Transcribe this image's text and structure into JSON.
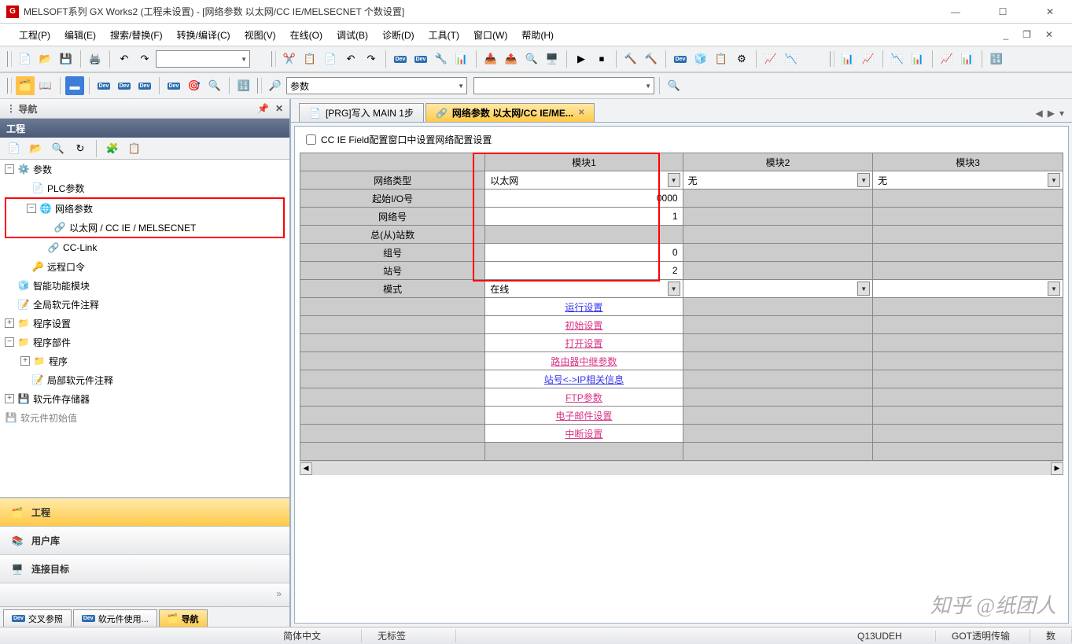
{
  "title": "MELSOFT系列 GX Works2 (工程未设置) - [网络参数  以太网/CC IE/MELSECNET 个数设置]",
  "menus": [
    "工程(P)",
    "编辑(E)",
    "搜索/替换(F)",
    "转换/编译(C)",
    "视图(V)",
    "在线(O)",
    "调试(B)",
    "诊断(D)",
    "工具(T)",
    "窗口(W)",
    "帮助(H)"
  ],
  "combo_param": "参数",
  "nav_title": "导航",
  "nav_sub": "工程",
  "tree": {
    "root": "参数",
    "plc": "PLC参数",
    "net": "网络参数",
    "eth": "以太网 / CC IE / MELSECNET",
    "cclink": "CC-Link",
    "remote": "远程口令",
    "smart": "智能功能模块",
    "global": "全局软元件注释",
    "progset": "程序设置",
    "progparts": "程序部件",
    "program": "程序",
    "local": "局部软元件注释",
    "devmem": "软元件存储器",
    "devinit": "软元件初始值"
  },
  "navbtns": {
    "proj": "工程",
    "user": "用户库",
    "conn": "连接目标"
  },
  "sidetabs": {
    "cross": "交叉参照",
    "dev": "软元件使用...",
    "nav": "导航"
  },
  "tabs": {
    "main": "[PRG]写入 MAIN 1步",
    "net": "网络参数  以太网/CC IE/ME..."
  },
  "checkbox": "CC IE Field配置窗口中设置网络配置设置",
  "gridhead": {
    "mod1": "模块1",
    "mod2": "模块2",
    "mod3": "模块3"
  },
  "rows": {
    "type": "网络类型",
    "io": "起始I/O号",
    "netno": "网络号",
    "total": "总(从)站数",
    "group": "组号",
    "station": "站号",
    "mode": "模式"
  },
  "vals": {
    "type1": "以太网",
    "type2": "无",
    "type3": "无",
    "io1": "0000",
    "netno1": "1",
    "group1": "0",
    "station1": "2",
    "mode1": "在线"
  },
  "links": {
    "run": "运行设置",
    "init": "初始设置",
    "open": "打开设置",
    "router": "路由器中继参数",
    "ip": "站号<->IP相关信息",
    "ftp": "FTP参数",
    "mail": "电子邮件设置",
    "intr": "中断设置"
  },
  "status": {
    "lang": "简体中文",
    "label": "无标签",
    "cpu": "Q13UDEH",
    "conn": "GOT透明传输",
    "num": "数"
  },
  "watermark": "知乎 @纸团人"
}
